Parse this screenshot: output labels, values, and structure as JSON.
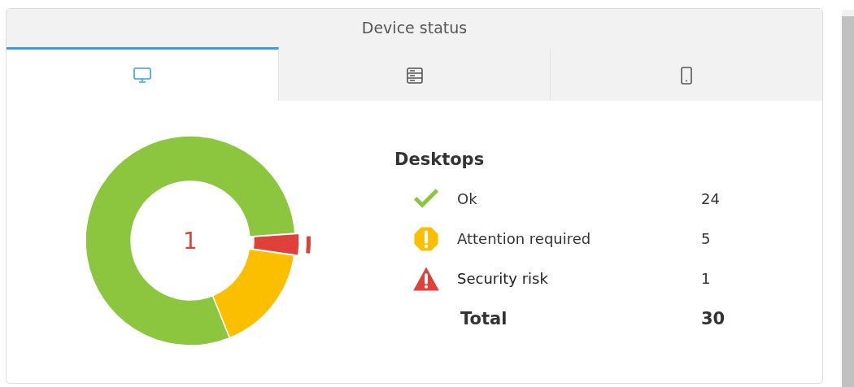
{
  "panel": {
    "title": "Device status"
  },
  "tabs": [
    {
      "kind": "desktop",
      "selected": true
    },
    {
      "kind": "server",
      "selected": false
    },
    {
      "kind": "mobile",
      "selected": false
    }
  ],
  "summary": {
    "heading": "Desktops",
    "center_label": "1",
    "items": [
      {
        "kind": "ok",
        "label": "Ok",
        "count": "24",
        "color": "#8cc63f",
        "selected": false
      },
      {
        "kind": "attention",
        "label": "Attention required",
        "count": "5",
        "color": "#fbbf00",
        "selected": false
      },
      {
        "kind": "risk",
        "label": "Security risk",
        "count": "1",
        "color": "#e0403a",
        "selected": true
      }
    ],
    "total": {
      "label": "Total",
      "count": "30"
    }
  }
}
